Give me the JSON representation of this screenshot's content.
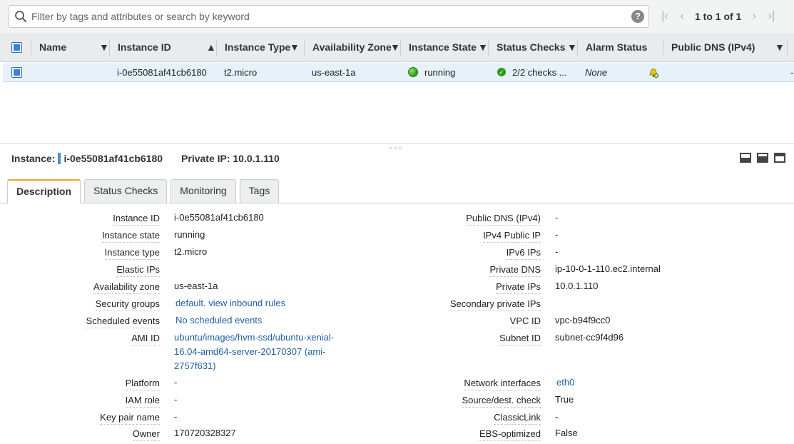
{
  "filter": {
    "placeholder": "Filter by tags and attributes or search by keyword",
    "help": "?",
    "pager_text": "1 to 1 of 1"
  },
  "table": {
    "columns": [
      "Name",
      "Instance ID",
      "Instance Type",
      "Availability Zone",
      "Instance State",
      "Status Checks",
      "Alarm Status",
      "Public DNS (IPv4)"
    ],
    "row": {
      "name": "",
      "instance_id": "i-0e55081af41cb6180",
      "instance_type": "t2.micro",
      "availability_zone": "us-east-1a",
      "instance_state": "running",
      "status_checks": "2/2 checks ...",
      "alarm_status": "None",
      "public_dns": "-"
    }
  },
  "detail": {
    "instance_label": "Instance:",
    "instance_id": "i-0e55081af41cb6180",
    "private_ip": "Private IP: 10.0.1.110",
    "tabs": [
      "Description",
      "Status Checks",
      "Monitoring",
      "Tags"
    ],
    "left": [
      {
        "label": "Instance ID",
        "value": "i-0e55081af41cb6180"
      },
      {
        "label": "Instance state",
        "value": "running"
      },
      {
        "label": "Instance type",
        "value": "t2.micro"
      },
      {
        "label": "Elastic IPs",
        "value": ""
      },
      {
        "label": "Availability zone",
        "value": "us-east-1a"
      },
      {
        "label": "Security groups",
        "value": "default",
        "link2": "view inbound rules"
      },
      {
        "label": "Scheduled events",
        "value": "No scheduled events"
      },
      {
        "label": "AMI ID",
        "value": "ubuntu/images/hvm-ssd/ubuntu-xenial-16.04-amd64-server-20170307 (ami-2757f631)"
      },
      {
        "label": "Platform",
        "value": "-"
      },
      {
        "label": "IAM role",
        "value": "-"
      },
      {
        "label": "Key pair name",
        "value": "-"
      },
      {
        "label": "Owner",
        "value": "170720328327"
      }
    ],
    "right": [
      {
        "label": "Public DNS (IPv4)",
        "value": "-"
      },
      {
        "label": "IPv4 Public IP",
        "value": "-"
      },
      {
        "label": "IPv6 IPs",
        "value": "-"
      },
      {
        "label": "Private DNS",
        "value": "ip-10-0-1-110.ec2.internal"
      },
      {
        "label": "Private IPs",
        "value": "10.0.1.110"
      },
      {
        "label": "Secondary private IPs",
        "value": ""
      },
      {
        "label": "VPC ID",
        "value": "vpc-b94f9cc0"
      },
      {
        "label": "Subnet ID",
        "value": "subnet-cc9f4d96"
      },
      {
        "label": "Network interfaces",
        "value": "eth0"
      },
      {
        "label": "Source/dest. check",
        "value": "True"
      },
      {
        "label": "ClassicLink",
        "value": "-"
      },
      {
        "label": "EBS-optimized",
        "value": "False"
      }
    ]
  },
  "colors": {
    "accent": "#f0a030",
    "link": "#1f5fa8",
    "selected_row": "#e7f1fa",
    "running": "#2e9b12"
  }
}
